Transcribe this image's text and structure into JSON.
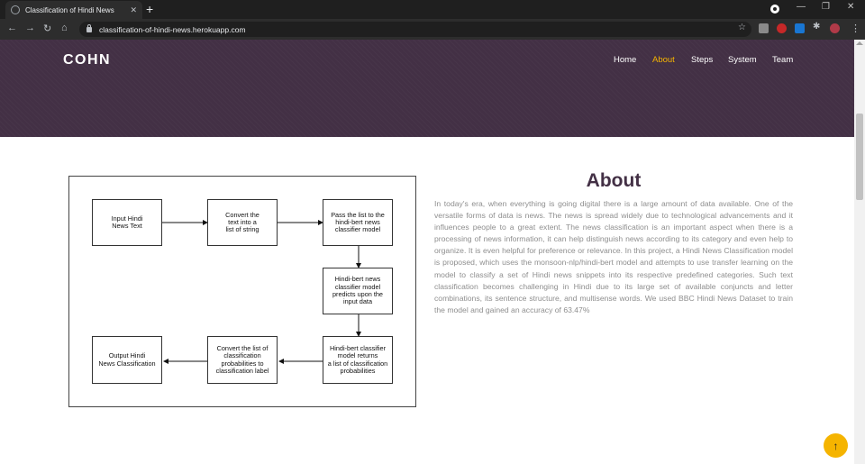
{
  "browser": {
    "tab_title": "Classification of Hindi News",
    "tab_close": "✕",
    "new_tab": "+",
    "url": "classification-of-hindi-news.herokuapp.com",
    "back": "←",
    "forward": "→",
    "reload": "↻",
    "home": "⌂",
    "bookmark": "☆",
    "menu": "⋮",
    "minimize": "—",
    "restore": "❐",
    "close": "✕"
  },
  "site": {
    "brand": "COHN",
    "nav": [
      {
        "label": "Home"
      },
      {
        "label": "About",
        "active": true
      },
      {
        "label": "Steps"
      },
      {
        "label": "System"
      },
      {
        "label": "Team"
      }
    ],
    "accent_color": "#f5b400",
    "header_color": "#433045"
  },
  "diagram": {
    "boxes": [
      {
        "label": "Input Hindi\nNews Text"
      },
      {
        "label": "Convert the\ntext into a\nlist of string"
      },
      {
        "label": "Pass the list to the\nhindi-bert news\nclassifier model"
      },
      {
        "label": "Hindi-bert news\nclassifier model\npredicts upon the\ninput data"
      },
      {
        "label": "Hindi-bert classifier\nmodel returns\na list of classification\nprobabilities"
      },
      {
        "label": "Convert the list of\nclassification\nprobabilities to\nclassification label"
      },
      {
        "label": "Output Hindi\nNews Classification"
      }
    ]
  },
  "about": {
    "title": "About",
    "text": "In today's era, when everything is going digital there is a large amount of data available. One of the versatile forms of data is news. The news is spread widely due to technological advancements and it influences people to a great extent. The news classification is an important aspect when there is a processing of news information, it can help distinguish news according to its category and even help to organize. It is even helpful for preference or relevance. In this project, a Hindi News Classification model is proposed, which uses the monsoon-nlp/hindi-bert model and attempts to use transfer learning on the model to classify a set of Hindi news snippets into its respective predefined categories. Such text classification becomes challenging in Hindi due to its large set of available conjuncts and letter combinations, its sentence structure, and multisense words. We used BBC Hindi News Dataset to train the model and gained an accuracy of 63.47%"
  },
  "back_to_top": "↑"
}
